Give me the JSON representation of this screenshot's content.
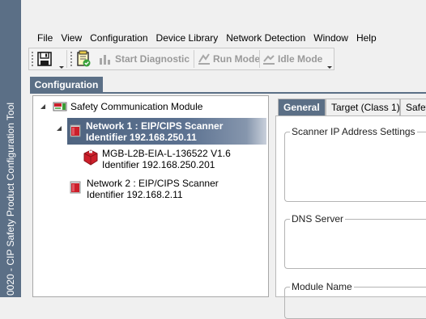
{
  "window": {
    "title": "0020 - CIP Safety Product Configuration Tool"
  },
  "menu": [
    "File",
    "View",
    "Configuration",
    "Device Library",
    "Network Detection",
    "Window",
    "Help"
  ],
  "toolbar": {
    "start_diagnostic": "Start Diagnostic",
    "run_mode": "Run Mode",
    "idle_mode": "Idle Mode"
  },
  "main_tab": "Configuration",
  "tree": {
    "root": "Safety Communication Module",
    "network1": {
      "line1": "Network 1 : EIP/CIPS Scanner",
      "line2": "Identifier 192.168.250.11"
    },
    "device1": {
      "line1": "MGB-L2B-EIA-L-136522 V1.6",
      "line2": "Identifier 192.168.250.201"
    },
    "network2": {
      "line1": "Network 2 : EIP/CIPS Scanner",
      "line2": "Identifier 192.168.2.11"
    }
  },
  "tabs": [
    "General",
    "Target (Class 1)",
    "Safety"
  ],
  "groups": {
    "scanner_ip": "Scanner IP Address Settings",
    "dns": "DNS Server",
    "module_name": "Module Name"
  },
  "colors": {
    "accent": "#5b6f86",
    "selection": "#4f6480",
    "error_icon": "#cc1f2a"
  }
}
